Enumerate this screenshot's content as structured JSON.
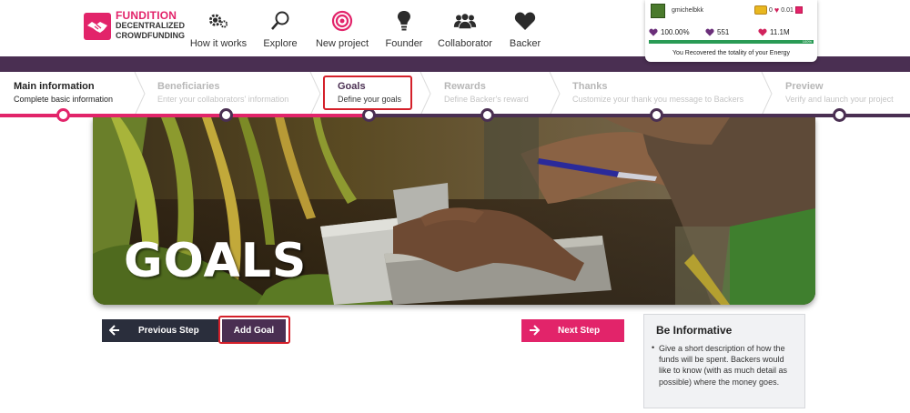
{
  "brand": {
    "line1": "FUNDITION",
    "line2": "DECENTRALIZED",
    "line3": "CROWDFUNDING",
    "accent_color": "#e2246a",
    "secondary_color": "#4a2f52"
  },
  "nav": {
    "items": [
      {
        "label": "How it works",
        "icon": "gears-icon"
      },
      {
        "label": "Explore",
        "icon": "search-icon"
      },
      {
        "label": "New project",
        "icon": "target-icon"
      },
      {
        "label": "Founder",
        "icon": "lightbulb-icon"
      },
      {
        "label": "Collaborator",
        "icon": "group-icon"
      },
      {
        "label": "Backer",
        "icon": "heart-icon"
      }
    ]
  },
  "user": {
    "name": "gmichelbkk",
    "coin_count": "0",
    "heart_value": "0.01",
    "percent": "100.00%",
    "votes": "551",
    "power": "11.1M",
    "energy_percent_small": "100%",
    "energy_level": 1.0,
    "energy_message": "You Recovered the totality of your Energy"
  },
  "steps": [
    {
      "title": "Main information",
      "subtitle": "Complete basic information",
      "state": "done"
    },
    {
      "title": "Beneficiaries",
      "subtitle": "Enter your collaborators' information",
      "state": "pending"
    },
    {
      "title": "Goals",
      "subtitle": "Define your goals",
      "state": "current"
    },
    {
      "title": "Rewards",
      "subtitle": "Define Backer's reward",
      "state": "pending"
    },
    {
      "title": "Thanks",
      "subtitle": "Customize your thank you message to Backers",
      "state": "pending"
    },
    {
      "title": "Preview",
      "subtitle": "Verify and launch your project",
      "state": "pending"
    }
  ],
  "hero": {
    "title": "GOALS"
  },
  "buttons": {
    "previous": "Previous Step",
    "add_goal": "Add Goal",
    "next": "Next Step"
  },
  "info": {
    "title": "Be Informative",
    "text": "Give a short description of how the funds will be spent. Backers would like to know (with as much detail as possible) where the money goes."
  }
}
